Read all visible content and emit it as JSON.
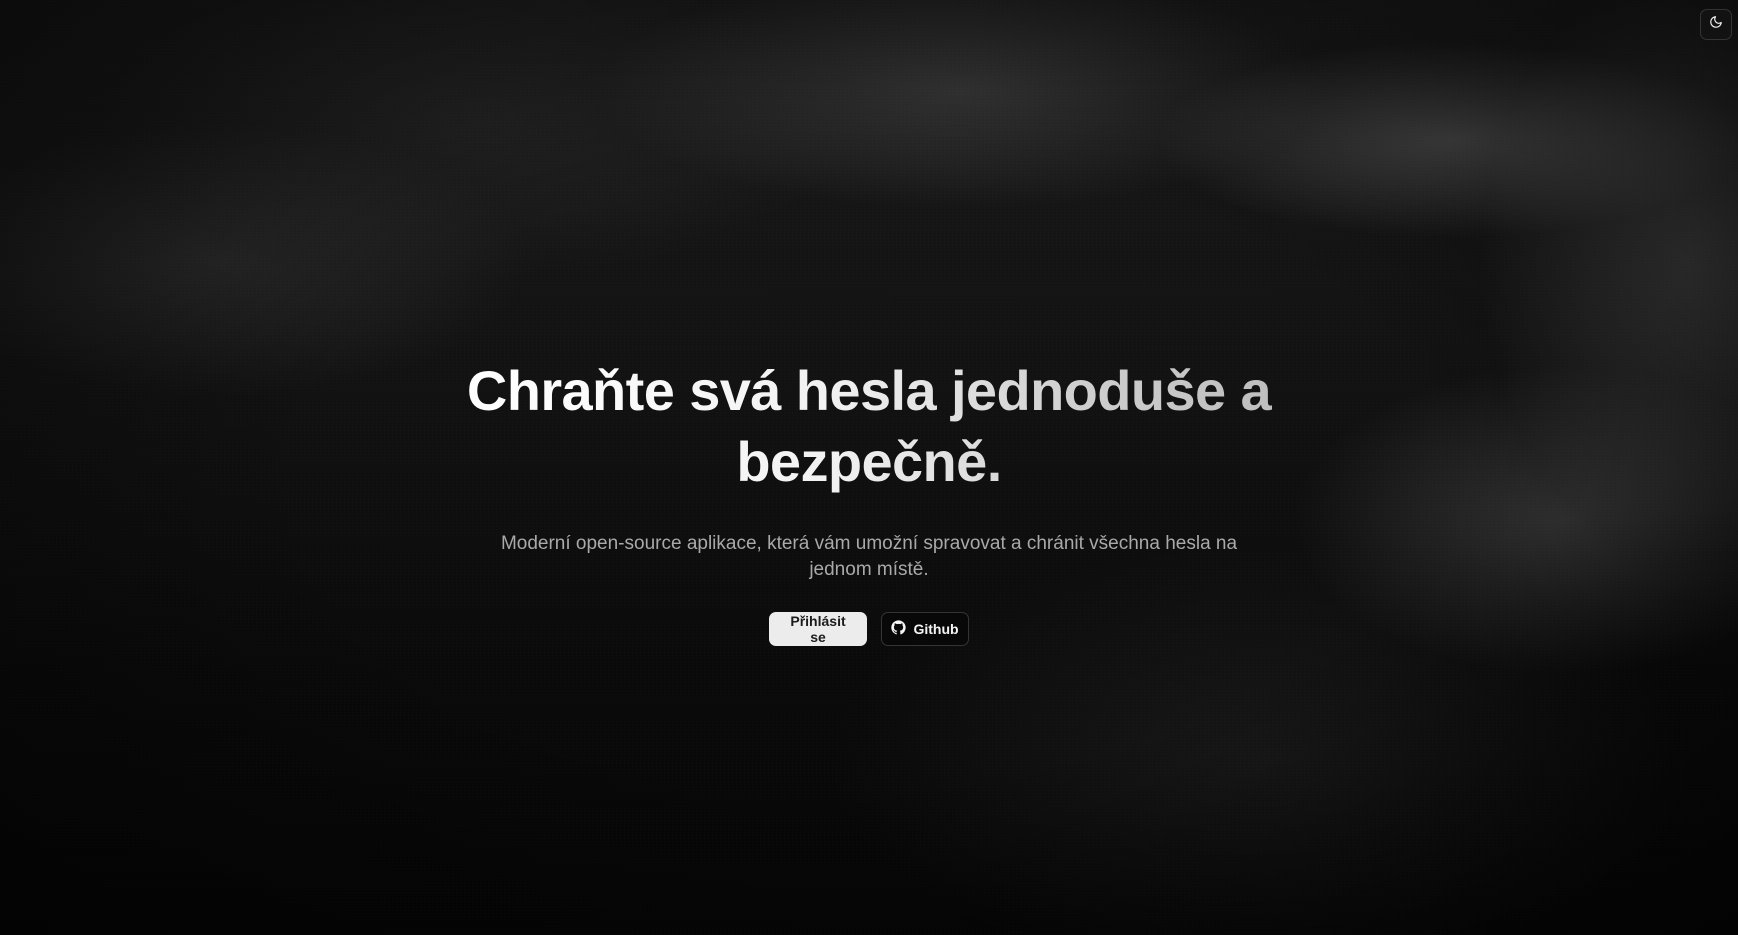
{
  "header": {
    "theme_toggle_icon": "moon-icon"
  },
  "hero": {
    "headline": "Chraňte svá hesla jednoduše a bezpečně.",
    "subtitle": "Moderní open-source aplikace, která vám umožní spravovat a chránit všechna hesla na jednom místě."
  },
  "actions": {
    "login_label": "Přihlásit se",
    "github_label": "Github",
    "github_icon": "github-icon"
  },
  "colors": {
    "background": "#080808",
    "primary_button_bg": "#ececec",
    "primary_button_text": "#1c1c1c",
    "secondary_button_bg": "#080808",
    "text_light": "#f2f2f2",
    "text_muted": "#a9a9a9"
  }
}
